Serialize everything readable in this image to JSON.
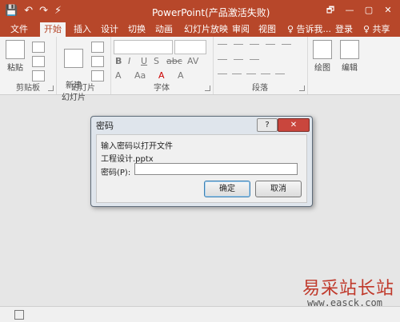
{
  "app": {
    "title": "PowerPoint(产品激活失败)",
    "window_buttons": [
      "🗗",
      "—",
      "▢",
      "✕"
    ],
    "quick_access": [
      "💾",
      "↶",
      "↷",
      "⚡"
    ]
  },
  "tabs": [
    {
      "label": "文件",
      "active": false
    },
    {
      "label": "开始",
      "active": true
    },
    {
      "label": "插入",
      "active": false
    },
    {
      "label": "设计",
      "active": false
    },
    {
      "label": "切换",
      "active": false
    },
    {
      "label": "动画",
      "active": false
    },
    {
      "label": "幻灯片放映",
      "active": false
    },
    {
      "label": "审阅",
      "active": false
    },
    {
      "label": "视图",
      "active": false
    },
    {
      "label": "♀ 告诉我...",
      "active": false
    },
    {
      "label": "登录",
      "active": false
    },
    {
      "label": "♀ 共享",
      "active": false
    }
  ],
  "ribbon": {
    "groups": [
      {
        "label": "剪贴板"
      },
      {
        "label": "幻灯片"
      },
      {
        "label": "字体"
      },
      {
        "label": "段落"
      }
    ],
    "paste_label": "粘贴",
    "new_slide_label": "新建\n幻灯片",
    "drawing_label": "绘图",
    "editing_label": "编辑",
    "font_buttons": [
      "B",
      "I",
      "U",
      "S",
      "abc",
      "AV"
    ],
    "font_buttons2": [
      "A",
      "Aa",
      "A",
      "A"
    ]
  },
  "dialog": {
    "title": "密码",
    "help_label": "?",
    "close_label": "✕",
    "message_line1": "输入密码以打开文件",
    "message_line2": "工程设计.pptx",
    "password_label": "密码(P):",
    "password_value": "",
    "ok_label": "确定",
    "cancel_label": "取消"
  },
  "status_bar": {
    "icon": "notes-icon"
  },
  "watermark": {
    "line1": "易采站长站",
    "line2": "www.easck.com"
  },
  "colors": {
    "accent": "#b7472a",
    "close_button": "#c9463d"
  }
}
